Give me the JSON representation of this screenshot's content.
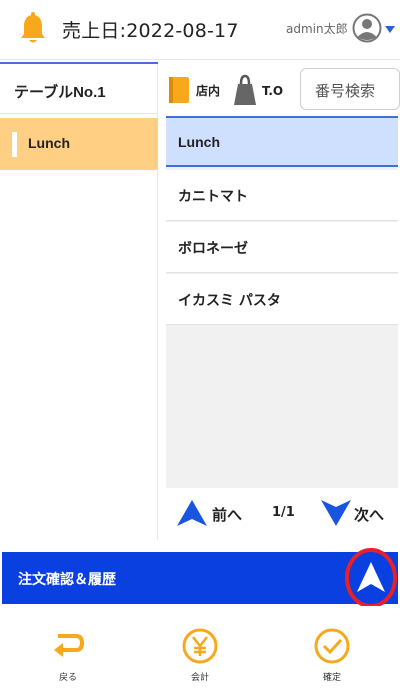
{
  "header": {
    "sales_date": "売上日:2022-08-17",
    "user_name": "admin太郎",
    "bell_icon": "bell-icon",
    "avatar_icon": "user-avatar-icon",
    "caret_icon": "chevron-down-icon"
  },
  "sidebar": {
    "table_label": "テーブルNo.1",
    "categories": [
      {
        "label": "Lunch",
        "selected": true
      }
    ]
  },
  "toolbar": {
    "dine_in_label": "店内",
    "takeout_label": "T.O",
    "search_label": "番号検索"
  },
  "menu": {
    "header": "Lunch",
    "items": [
      {
        "label": "カニトマト"
      },
      {
        "label": "ボロネーゼ"
      },
      {
        "label": "イカスミ パスタ"
      }
    ]
  },
  "pager": {
    "prev_label": "前へ",
    "page_indicator": "1/1",
    "next_label": "次へ"
  },
  "order_bar": {
    "label": "注文確認＆履歴"
  },
  "footer": {
    "back_label": "戻る",
    "checkout_label": "会計",
    "confirm_label": "確定"
  },
  "colors": {
    "accent_orange": "#f7a81b",
    "primary_blue": "#0a3fe0",
    "selected_category": "#ffd083",
    "selected_menu_header": "#cfe0ff",
    "highlight_red": "#e8202a"
  }
}
